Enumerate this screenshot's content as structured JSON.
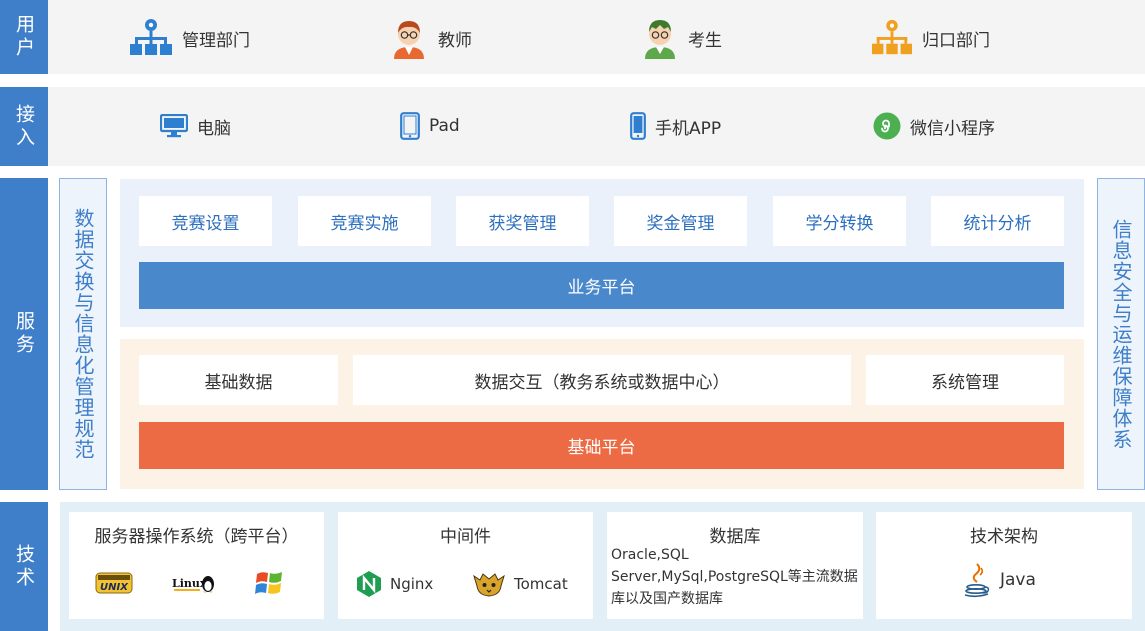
{
  "rows": {
    "user": "用户",
    "access": "接入",
    "service": "服务",
    "tech": "技术"
  },
  "users": [
    {
      "label": "管理部门",
      "icon": "org-chart-icon",
      "color": "#2f7fd1"
    },
    {
      "label": "教师",
      "icon": "teacher-avatar-icon",
      "color": "#e8682f"
    },
    {
      "label": "考生",
      "icon": "student-avatar-icon",
      "color": "#5ea84c"
    },
    {
      "label": "归口部门",
      "icon": "org-chart-icon",
      "color": "#f0a020"
    }
  ],
  "access": [
    {
      "label": "电脑",
      "icon": "monitor-icon"
    },
    {
      "label": "Pad",
      "icon": "tablet-icon"
    },
    {
      "label": "手机APP",
      "icon": "phone-icon"
    },
    {
      "label": "微信小程序",
      "icon": "mini-program-icon"
    }
  ],
  "services": {
    "left_vertical": "数据交换与信息化管理规范",
    "right_vertical": "信息安全与运维保障体系",
    "business_modules": [
      "竞赛设置",
      "竞赛实施",
      "获奖管理",
      "奖金管理",
      "学分转换",
      "统计分析"
    ],
    "business_platform": "业务平台",
    "base_modules": [
      "基础数据",
      "数据交互（教务系统或数据中心）",
      "系统管理"
    ],
    "base_platform": "基础平台"
  },
  "tech": {
    "os": {
      "title": "服务器操作系统（跨平台）",
      "logos": [
        "unix-logo-icon",
        "linux-logo-icon",
        "windows-logo-icon"
      ],
      "unix_text": "UNIX",
      "linux_text": "Linux"
    },
    "middleware": {
      "title": "中间件",
      "items": [
        "Nginx",
        "Tomcat"
      ]
    },
    "database": {
      "title": "数据库",
      "text": "Oracle,SQL Server,MySql,PostgreSQL等主流数据库以及国产数据库"
    },
    "architecture": {
      "title": "技术架构",
      "items": [
        "Java"
      ]
    }
  },
  "colors": {
    "primary_blue": "#3f7ec8",
    "business_bar": "#4a88cc",
    "base_bar": "#ec6b45",
    "nginx_green": "#1f9e52"
  }
}
